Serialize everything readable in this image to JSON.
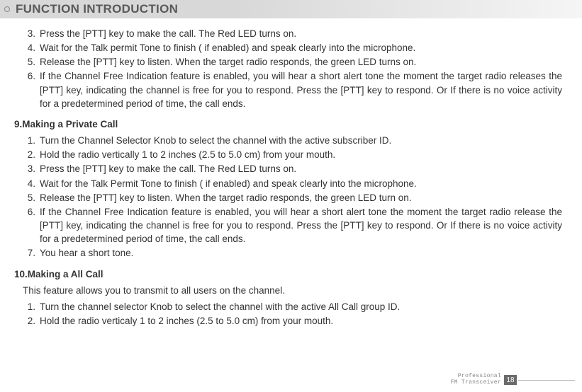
{
  "header": {
    "title": "FUNCTION INTRODUCTION"
  },
  "top_list": [
    {
      "n": "3.",
      "t": "Press the [PTT] key to make the call. The Red LED turns on."
    },
    {
      "n": "4.",
      "t": "Wait for the Talk permit Tone to finish ( if enabled) and speak clearly into the microphone."
    },
    {
      "n": "5.",
      "t": "Release the [PTT] key to listen. When the target radio responds, the green LED turns on."
    },
    {
      "n": "6.",
      "t": "If the Channel Free Indication feature is enabled, you will hear a short alert tone the moment the target radio releases the [PTT] key, indicating the channel is free for you to respond. Press the [PTT] key to respond. Or If there is no voice activity for a predetermined period of time, the call ends."
    }
  ],
  "sec9": {
    "title": "9.Making a Private Call",
    "items": [
      {
        "n": "1.",
        "t": "Turn the Channel Selector Knob to select the channel with the active subscriber ID."
      },
      {
        "n": "2.",
        "t": "Hold the radio vertically 1 to 2 inches (2.5 to 5.0 cm) from your mouth."
      },
      {
        "n": "3.",
        "t": "Press the [PTT] key to make the call. The Red LED turns on."
      },
      {
        "n": "4.",
        "t": "Wait for the Talk Permit Tone to finish ( if enabled) and speak clearly into the microphone."
      },
      {
        "n": "5.",
        "t": "Release the [PTT] key to listen. When the target radio responds, the green LED turn on."
      },
      {
        "n": "6.",
        "t": "If the Channel Free Indication feature is enabled, you will hear a short alert tone the moment the target radio release the [PTT] key, indicating the channel is free for you to respond. Press the [PTT] key to respond. Or If there is no voice activity for a predetermined period of time, the call ends."
      },
      {
        "n": "7.",
        "t": "You hear a short tone."
      }
    ]
  },
  "sec10": {
    "title": "10.Making a All Call",
    "intro": "This feature allows you to transmit to all users on the channel.",
    "items": [
      {
        "n": "1.",
        "t": "Turn the channel selector Knob to select the channel with the active All Call group ID."
      },
      {
        "n": "2.",
        "t": "Hold the radio verticaly 1 to 2 inches (2.5 to 5.0 cm) from your mouth."
      }
    ]
  },
  "footer": {
    "line1": "Professional",
    "line2": "FM Transceiver",
    "page": "18"
  }
}
